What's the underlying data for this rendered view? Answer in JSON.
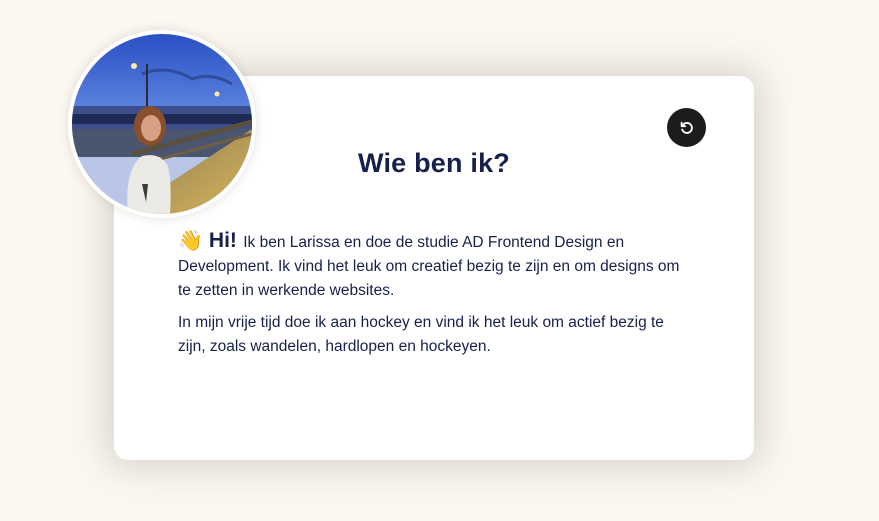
{
  "card": {
    "title": "Wie ben ik?",
    "greeting_icon": "waving-hand-icon",
    "greeting_emoji": "👋",
    "greeting": "Hi!",
    "intro": "Ik ben Larissa en doe de studie AD Frontend Design en Development. Ik vind het leuk om creatief bezig te zijn en om designs om te zetten in werkende websites.",
    "hobbies": "In mijn vrije tijd doe ik aan hockey en vind ik het leuk om actief bezig te zijn, zoals wandelen, hardlopen en hockeyen.",
    "flip_icon": "rotate-icon"
  },
  "colors": {
    "background": "#fbf7f1",
    "card": "#ffffff",
    "text": "#16204a",
    "button": "#1c1c1c"
  }
}
